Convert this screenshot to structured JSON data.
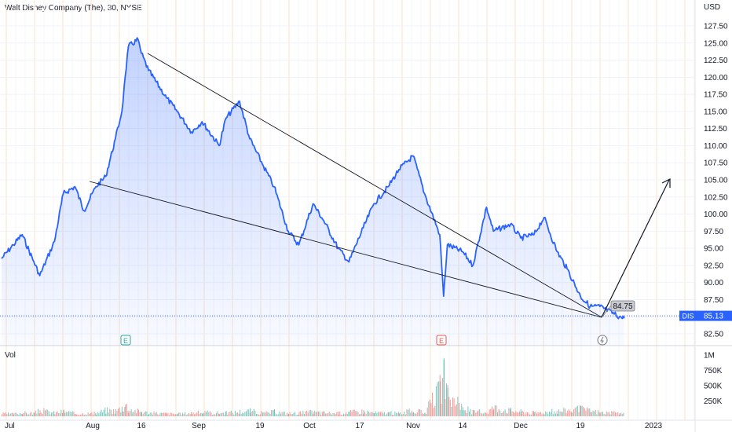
{
  "header": {
    "title": "Walt Disney Company (The), 30, NYSE"
  },
  "currency": "USD",
  "price_tag": {
    "symbol": "DIS",
    "value": "85.13"
  },
  "callout": {
    "value": "84.75"
  },
  "volume_label": "Vol",
  "event_markers": [
    "E",
    "E"
  ],
  "colors": {
    "line": "#2962ff",
    "fill": "#2962ff",
    "up": "#26a69a",
    "down": "#ef5350",
    "grid": "#f0f3fa"
  },
  "chart_data": {
    "type": "area",
    "symbol": "DIS",
    "x_ticks": [
      "Jul",
      "Aug",
      "16",
      "Sep",
      "19",
      "Oct",
      "17",
      "Nov",
      "14",
      "Dec",
      "19",
      "2023"
    ],
    "y_ticks": [
      "82.50",
      "85.00",
      "87.50",
      "90.00",
      "92.50",
      "95.00",
      "97.50",
      "100.00",
      "102.50",
      "105.00",
      "107.50",
      "110.00",
      "112.50",
      "115.00",
      "117.50",
      "120.00",
      "122.50",
      "125.00",
      "127.50"
    ],
    "ylim": [
      82.5,
      127.5
    ],
    "vol_ticks": [
      "1M",
      "750K",
      "500K",
      "250K"
    ],
    "x": [
      "2022-07-01",
      "2022-07-05",
      "2022-07-08",
      "2022-07-12",
      "2022-07-14",
      "2022-07-19",
      "2022-07-22",
      "2022-07-26",
      "2022-07-29",
      "2022-08-02",
      "2022-08-05",
      "2022-08-08",
      "2022-08-10",
      "2022-08-11",
      "2022-08-12",
      "2022-08-15",
      "2022-08-16",
      "2022-08-18",
      "2022-08-23",
      "2022-08-26",
      "2022-08-30",
      "2022-09-02",
      "2022-09-07",
      "2022-09-09",
      "2022-09-13",
      "2022-09-16",
      "2022-09-20",
      "2022-09-23",
      "2022-09-27",
      "2022-09-30",
      "2022-10-04",
      "2022-10-07",
      "2022-10-11",
      "2022-10-14",
      "2022-10-18",
      "2022-10-21",
      "2022-10-25",
      "2022-10-28",
      "2022-11-01",
      "2022-11-04",
      "2022-11-08",
      "2022-11-09",
      "2022-11-10",
      "2022-11-14",
      "2022-11-17",
      "2022-11-21",
      "2022-11-23",
      "2022-11-28",
      "2022-12-01",
      "2022-12-05",
      "2022-12-08",
      "2022-12-12",
      "2022-12-15",
      "2022-12-19",
      "2022-12-21",
      "2022-12-23",
      "2022-12-27",
      "2022-12-28"
    ],
    "y": [
      93.5,
      95.5,
      97.0,
      93.0,
      91.0,
      96.0,
      103.0,
      104.0,
      100.5,
      104.0,
      105.5,
      111.0,
      115.0,
      120.0,
      124.5,
      125.5,
      123.5,
      121.0,
      117.0,
      115.0,
      112.0,
      113.5,
      110.0,
      114.0,
      116.5,
      111.0,
      107.0,
      104.0,
      97.5,
      95.5,
      101.5,
      99.0,
      95.0,
      93.0,
      98.0,
      101.5,
      104.0,
      106.5,
      108.5,
      103.0,
      97.0,
      88.0,
      95.5,
      94.5,
      92.5,
      101.0,
      97.5,
      98.5,
      96.5,
      97.0,
      99.5,
      94.5,
      92.0,
      88.0,
      86.5,
      86.5,
      85.0,
      84.75
    ],
    "volume_ylim": [
      0,
      1000000
    ],
    "volume_approx": [
      70000,
      60000,
      90000,
      80000,
      150000,
      90000,
      130000,
      70000,
      70000,
      80000,
      160000,
      140000,
      230000,
      310000,
      190000,
      130000,
      120000,
      90000,
      70000,
      60000,
      90000,
      100000,
      90000,
      90000,
      120000,
      140000,
      80000,
      120000,
      70000,
      90000,
      110000,
      90000,
      80000,
      110000,
      130000,
      90000,
      90000,
      80000,
      150000,
      90000,
      700000,
      1000000,
      520000,
      220000,
      110000,
      120000,
      230000,
      150000,
      120000,
      90000,
      110000,
      130000,
      160000,
      180000,
      140000,
      100000,
      80000,
      60000
    ]
  }
}
